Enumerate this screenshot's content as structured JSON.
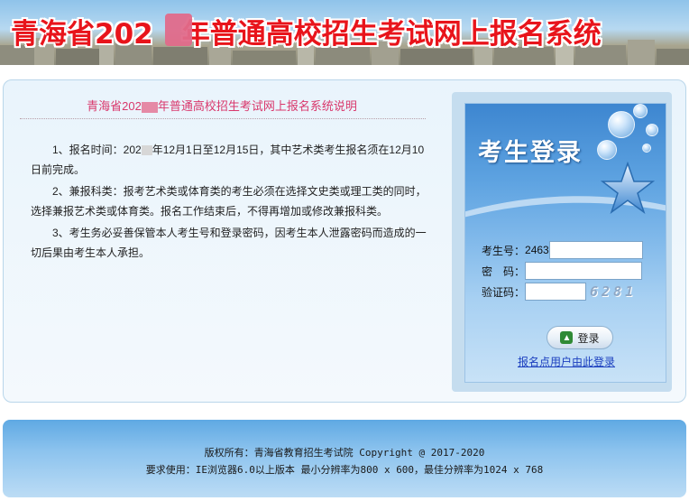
{
  "banner": {
    "title_prefix": "青海省202",
    "title_suffix": "年普通高校招生考试网上报名系统"
  },
  "notice": {
    "title_prefix": "青海省202",
    "title_suffix": "年普通高校招生考试网上报名系统说明",
    "items": [
      {
        "prefix": "1、报名时间：202",
        "suffix": "年12月1日至12月15日，其中艺术类考生报名须在12月10日前完成。"
      },
      {
        "text": "2、兼报科类：报考艺术类或体育类的考生必须在选择文史类或理工类的同时，选择兼报艺术类或体育类。报名工作结束后，不得再增加或修改兼报科类。"
      },
      {
        "text": "3、考生务必妥善保管本人考生号和登录密码，因考生本人泄露密码而造成的一切后果由考生本人承担。"
      }
    ]
  },
  "login": {
    "title": "考生登录",
    "exam_no_label": "考生号：",
    "exam_no_prefix": "2463",
    "password_label": "密　码：",
    "captcha_label": "验证码：",
    "captcha_text": "6281",
    "button_label": "登录",
    "help_link": "报名点用户由此登录"
  },
  "footer": {
    "copyright": "版权所有：青海省教育招生考试院 Copyright @ 2017-2020",
    "requirements": "要求使用：IE浏览器6.0以上版本 最小分辨率为800 x 600，最佳分辨率为1024 x 768"
  },
  "colors": {
    "banner_title": "#e8141b",
    "notice_title": "#d9386c",
    "link": "#1b3fbf"
  }
}
